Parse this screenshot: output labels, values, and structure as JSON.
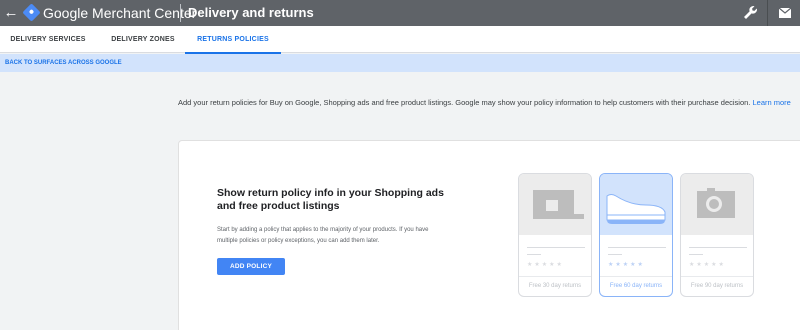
{
  "header": {
    "back_icon": "arrow-left-icon",
    "brand": "Google Merchant Center",
    "page_title": "Delivery and returns",
    "tools_icon": "wrench-icon",
    "mail_icon": "envelope-icon"
  },
  "tabs": [
    {
      "label": "DELIVERY SERVICES",
      "active": false
    },
    {
      "label": "DELIVERY ZONES",
      "active": false
    },
    {
      "label": "RETURNS POLICIES",
      "active": true
    }
  ],
  "banner": {
    "link": "BACK TO SURFACES ACROSS GOOGLE"
  },
  "intro": {
    "text": "Add your return policies for Buy on Google, Shopping ads and free product listings. Google may show your policy information to help customers with their purchase decision.",
    "learn_more": "Learn more"
  },
  "card": {
    "title": "Show return policy info in your Shopping ads and free product listings",
    "description": "Start by adding a policy that applies to the majority of your products. If you have multiple policies or policy exceptions, you can add them later.",
    "button": "ADD POLICY",
    "products": [
      {
        "icon": "laptop-icon",
        "stars": "★★★★★",
        "returns": "Free 30 day returns",
        "selected": false
      },
      {
        "icon": "shoe-icon",
        "stars": "★★★★★",
        "returns": "Free 60 day returns",
        "selected": true
      },
      {
        "icon": "camera-icon",
        "stars": "★★★★★",
        "returns": "Free 90 day returns",
        "selected": false
      }
    ]
  },
  "colors": {
    "topbar": "#5f6368",
    "accent": "#1a73e8",
    "banner": "#d2e3fc",
    "button": "#4285f4"
  }
}
